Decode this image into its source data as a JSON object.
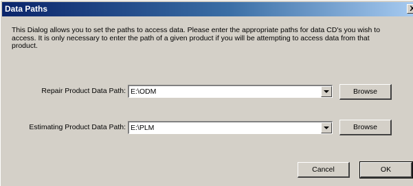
{
  "window": {
    "title": "Data Paths",
    "close_label": "X"
  },
  "intro": {
    "text": "This Dialog allows you to set the paths to access data.  Please enter the appropriate paths for data CD's you wish to access.  It is only necessary to enter the path of a given product if you will be attempting to access data from that product."
  },
  "fields": {
    "repair": {
      "label": "Repair Product Data Path:",
      "value": "E:\\ODM",
      "browse_label": "Browse"
    },
    "estimating": {
      "label": "Estimating Product Data Path:",
      "value": "E:\\PLM",
      "browse_label": "Browse"
    }
  },
  "footer": {
    "cancel_label": "Cancel",
    "ok_label": "OK"
  },
  "colors": {
    "face": "#d4d0c8",
    "title_start": "#0a246a",
    "title_end": "#a6caf0"
  }
}
